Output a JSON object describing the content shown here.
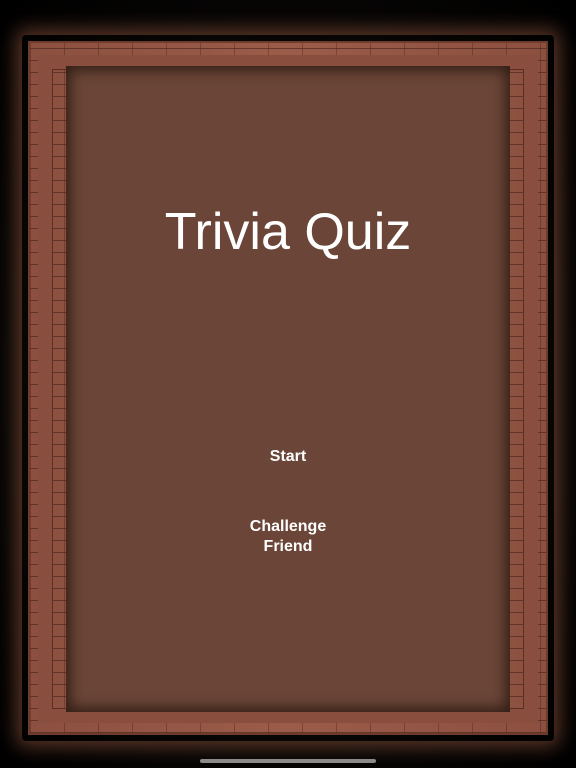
{
  "screen": {
    "title": "Trivia Quiz"
  },
  "menu": {
    "start_label": "Start",
    "challenge_label_line1": "Challenge",
    "challenge_label_line2": "Friend"
  },
  "colors": {
    "background": "#000000",
    "frame": "#9b5c49",
    "board": "#6b4638",
    "text": "#ffffff"
  }
}
